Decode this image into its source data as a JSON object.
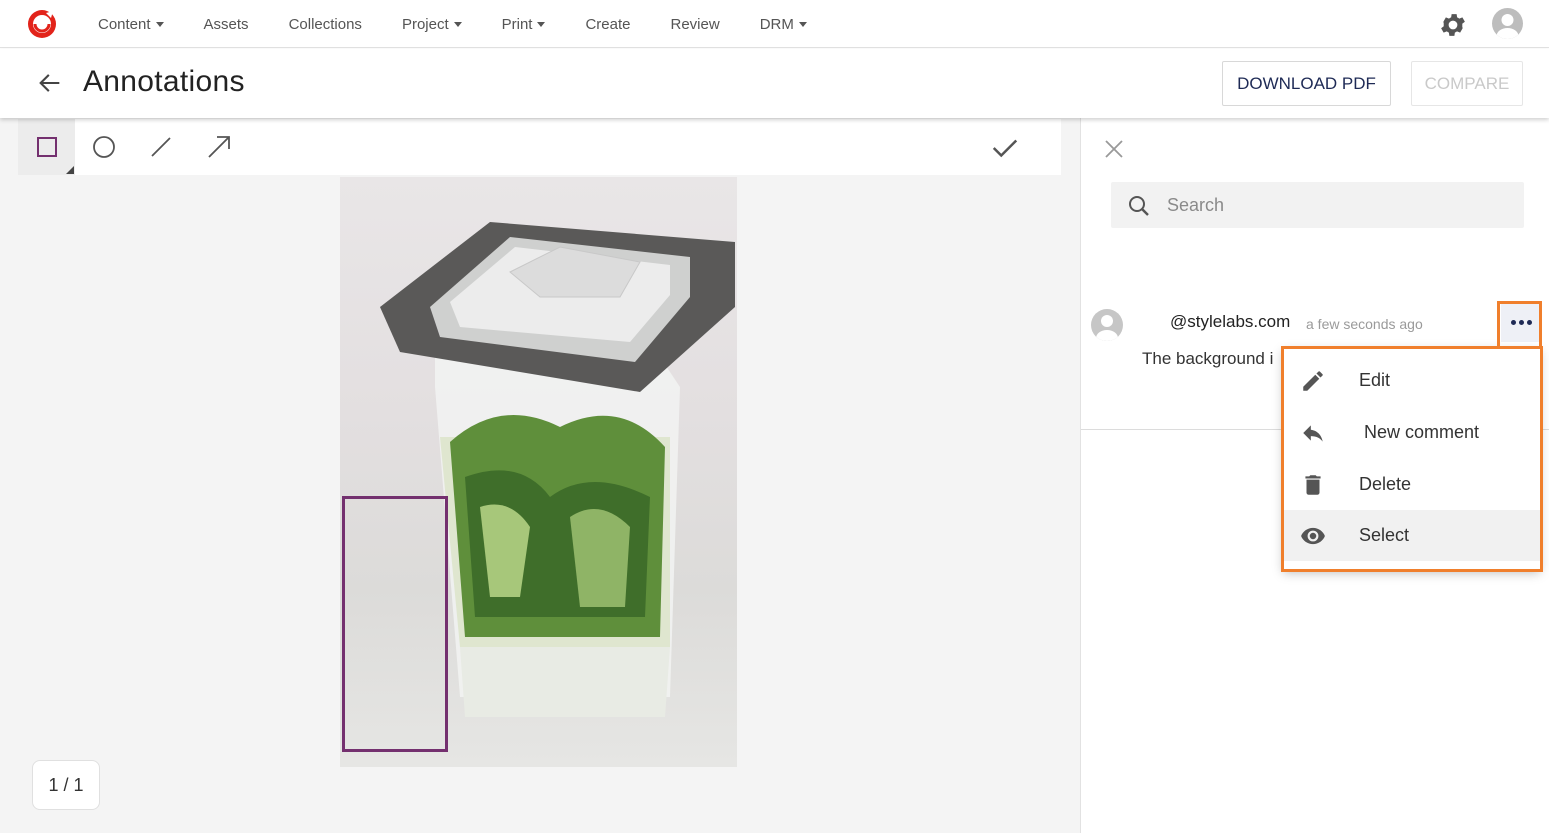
{
  "nav": {
    "items": [
      {
        "label": "Content",
        "dropdown": true
      },
      {
        "label": "Assets",
        "dropdown": false
      },
      {
        "label": "Collections",
        "dropdown": false
      },
      {
        "label": "Project",
        "dropdown": true
      },
      {
        "label": "Print",
        "dropdown": true
      },
      {
        "label": "Create",
        "dropdown": false
      },
      {
        "label": "Review",
        "dropdown": false
      },
      {
        "label": "DRM",
        "dropdown": true
      }
    ]
  },
  "header": {
    "title": "Annotations",
    "download_label": "DOWNLOAD PDF",
    "compare_label": "COMPARE"
  },
  "toolbar": {
    "tools": [
      "rectangle-icon",
      "circle-icon",
      "line-icon",
      "arrow-icon"
    ],
    "active_tool": "rectangle-icon"
  },
  "pager": {
    "label": "1 / 1"
  },
  "panel": {
    "search_placeholder": "Search",
    "comment": {
      "author": "@stylelabs.com",
      "time": "a few seconds ago",
      "body": "The background i"
    }
  },
  "menu": {
    "items": [
      {
        "label": "Edit",
        "icon": "pencil-icon"
      },
      {
        "label": "New comment",
        "icon": "reply-icon"
      },
      {
        "label": "Delete",
        "icon": "trash-icon"
      },
      {
        "label": "Select",
        "icon": "eye-icon"
      }
    ]
  },
  "colors": {
    "brand": "#e2231a",
    "annotation": "#74306f",
    "highlight": "#f07f2c",
    "primary_text": "#1e2a55"
  }
}
